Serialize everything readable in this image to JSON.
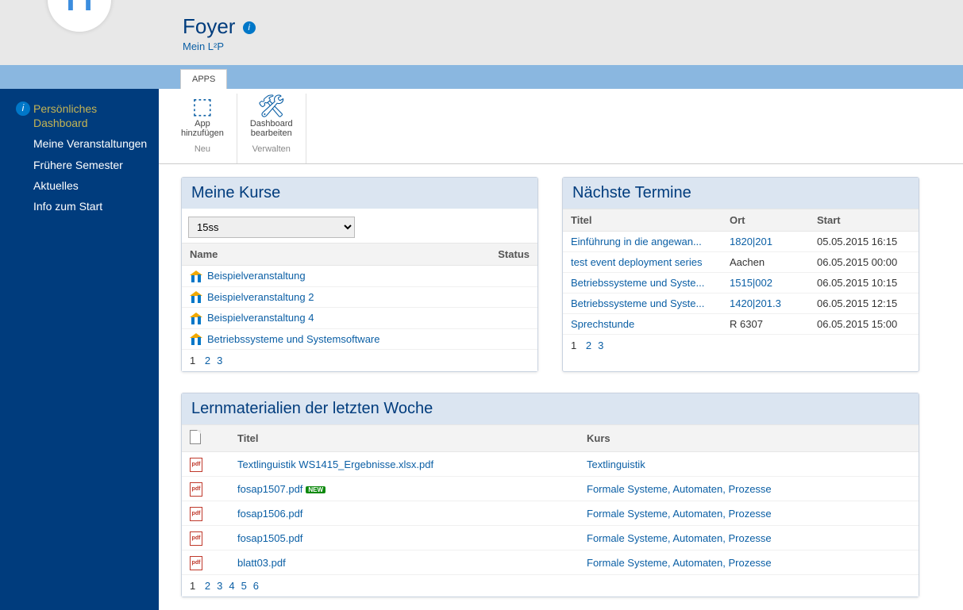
{
  "header": {
    "title": "Foyer",
    "subtitle": "Mein L²P"
  },
  "tabs": {
    "apps": "APPS"
  },
  "ribbon": {
    "add_app_line1": "App",
    "add_app_line2": "hinzufügen",
    "edit_dash_line1": "Dashboard",
    "edit_dash_line2": "bearbeiten",
    "group_new": "Neu",
    "group_manage": "Verwalten"
  },
  "sidebar": {
    "items": [
      {
        "label": "Persönliches Dashboard",
        "active": true
      },
      {
        "label": "Meine Veranstaltungen",
        "active": false
      },
      {
        "label": "Frühere Semester",
        "active": false
      },
      {
        "label": "Aktuelles",
        "active": false
      },
      {
        "label": "Info zum Start",
        "active": false
      }
    ]
  },
  "kurse": {
    "title": "Meine Kurse",
    "semester_selected": "15ss",
    "col_name": "Name",
    "col_status": "Status",
    "rows": [
      {
        "name": "Beispielveranstaltung"
      },
      {
        "name": "Beispielveranstaltung 2"
      },
      {
        "name": "Beispielveranstaltung 4"
      },
      {
        "name": "Betriebssysteme und Systemsoftware"
      }
    ],
    "pager": {
      "current": "1",
      "pages": [
        "2",
        "3"
      ]
    }
  },
  "termine": {
    "title": "Nächste Termine",
    "col_title": "Titel",
    "col_ort": "Ort",
    "col_start": "Start",
    "rows": [
      {
        "titel": "Einführung in die angewan...",
        "ort": "1820|201",
        "ort_link": true,
        "start": "05.05.2015 16:15"
      },
      {
        "titel": "test event deployment series",
        "ort": "Aachen",
        "ort_link": false,
        "start": "06.05.2015 00:00"
      },
      {
        "titel": "Betriebssysteme und Syste...",
        "ort": "1515|002",
        "ort_link": true,
        "start": "06.05.2015 10:15"
      },
      {
        "titel": "Betriebssysteme und Syste...",
        "ort": "1420|201.3",
        "ort_link": true,
        "start": "06.05.2015 12:15"
      },
      {
        "titel": "Sprechstunde",
        "ort": "R 6307",
        "ort_link": false,
        "start": "06.05.2015 15:00"
      }
    ],
    "pager": {
      "current": "1",
      "pages": [
        "2",
        "3"
      ]
    }
  },
  "lern": {
    "title": "Lernmaterialien der letzten Woche",
    "col_titel": "Titel",
    "col_kurs": "Kurs",
    "rows": [
      {
        "titel": "Textlinguistik WS1415_Ergebnisse.xlsx.pdf",
        "kurs": "Textlinguistik",
        "is_new": false
      },
      {
        "titel": "fosap1507.pdf",
        "kurs": "Formale Systeme, Automaten, Prozesse",
        "is_new": true
      },
      {
        "titel": "fosap1506.pdf",
        "kurs": "Formale Systeme, Automaten, Prozesse",
        "is_new": false
      },
      {
        "titel": "fosap1505.pdf",
        "kurs": "Formale Systeme, Automaten, Prozesse",
        "is_new": false
      },
      {
        "titel": "blatt03.pdf",
        "kurs": "Formale Systeme, Automaten, Prozesse",
        "is_new": false
      }
    ],
    "new_label": "NEW",
    "pager": {
      "current": "1",
      "pages": [
        "2",
        "3",
        "4",
        "5",
        "6"
      ]
    }
  }
}
